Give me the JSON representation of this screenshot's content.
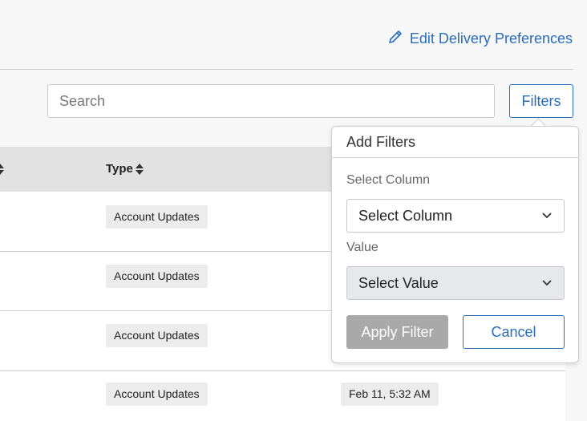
{
  "header": {
    "edit_link_label": "Edit Delivery Preferences",
    "edit_icon": "pencil-icon",
    "accent_color": "#2a6ebb"
  },
  "search": {
    "placeholder": "Search",
    "value": ""
  },
  "toolbar": {
    "filters_label": "Filters"
  },
  "table": {
    "columns": [
      "Type"
    ],
    "rows": [
      {
        "type": "Account Updates",
        "date": ""
      },
      {
        "type": "Account Updates",
        "date": ""
      },
      {
        "type": "Account Updates",
        "date": ""
      },
      {
        "type": "Account Updates",
        "date": "Feb 11, 5:32 AM"
      }
    ]
  },
  "filter_popover": {
    "title": "Add Filters",
    "column_label": "Select Column",
    "column_selected": "Select Column",
    "value_label": "Value",
    "value_selected": "Select Value",
    "apply_label": "Apply Filter",
    "cancel_label": "Cancel"
  }
}
